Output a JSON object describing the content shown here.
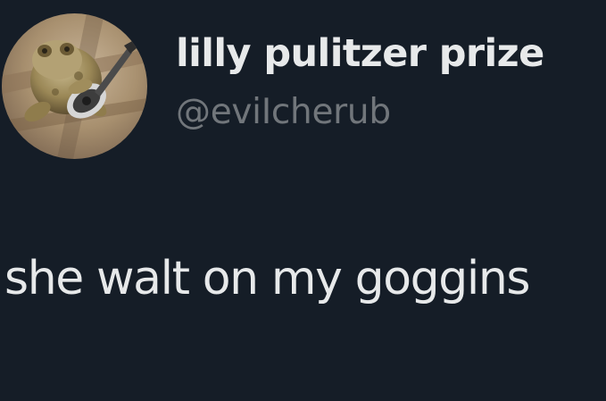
{
  "author": {
    "display_name": "lilly pulitzer prize",
    "handle": "@eviIcherub",
    "avatar_icon": "frog-with-guitar-avatar"
  },
  "tweet": {
    "text": "she walt on my goggins"
  },
  "colors": {
    "background": "#151d27",
    "primary_text": "#e7e9ea",
    "secondary_text": "#71767b"
  }
}
